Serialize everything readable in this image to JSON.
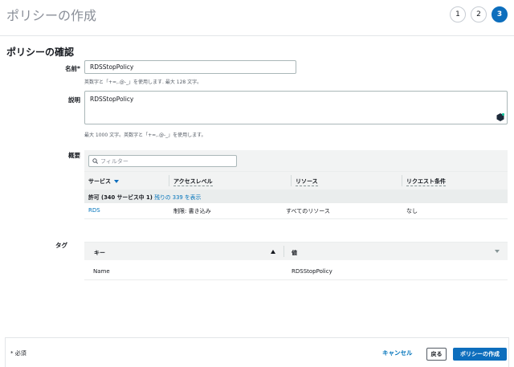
{
  "header": {
    "title": "ポリシーの作成",
    "steps": [
      "1",
      "2",
      "3"
    ],
    "active_step": "3"
  },
  "section": {
    "title": "ポリシーの確認"
  },
  "name_field": {
    "label": "名前*",
    "value": "RDSStopPolicy",
    "hint": "英数字と「+=,.@-_」を使用します. 最大 128 文字。"
  },
  "description_field": {
    "label": "説明",
    "value": "RDSStopPolicy",
    "hint": "最大 1000 文字。英数字と「+=,.@-_」を使用します。"
  },
  "summary": {
    "label": "概要",
    "filter_placeholder": "フィルター",
    "columns": [
      "サービス",
      "アクセスレベル",
      "リソース",
      "リクエスト条件"
    ],
    "group_text": "許可 (340 サービス中 1)",
    "group_link": "残りの 339 を表示",
    "rows": [
      {
        "service": "RDS",
        "access_level": "制限: 書き込み",
        "resource": "すべてのリソース",
        "condition": "なし"
      }
    ]
  },
  "tags": {
    "label": "タグ",
    "columns": [
      "キー",
      "値"
    ],
    "rows": [
      {
        "key": "Name",
        "value": "RDSStopPolicy"
      }
    ]
  },
  "footer": {
    "required_note": "* 必須",
    "cancel_label": "キャンセル",
    "back_label": "戻る",
    "create_label": "ポリシーの作成"
  },
  "colors": {
    "accent": "#0d6ebd",
    "link": "#0073bb"
  }
}
